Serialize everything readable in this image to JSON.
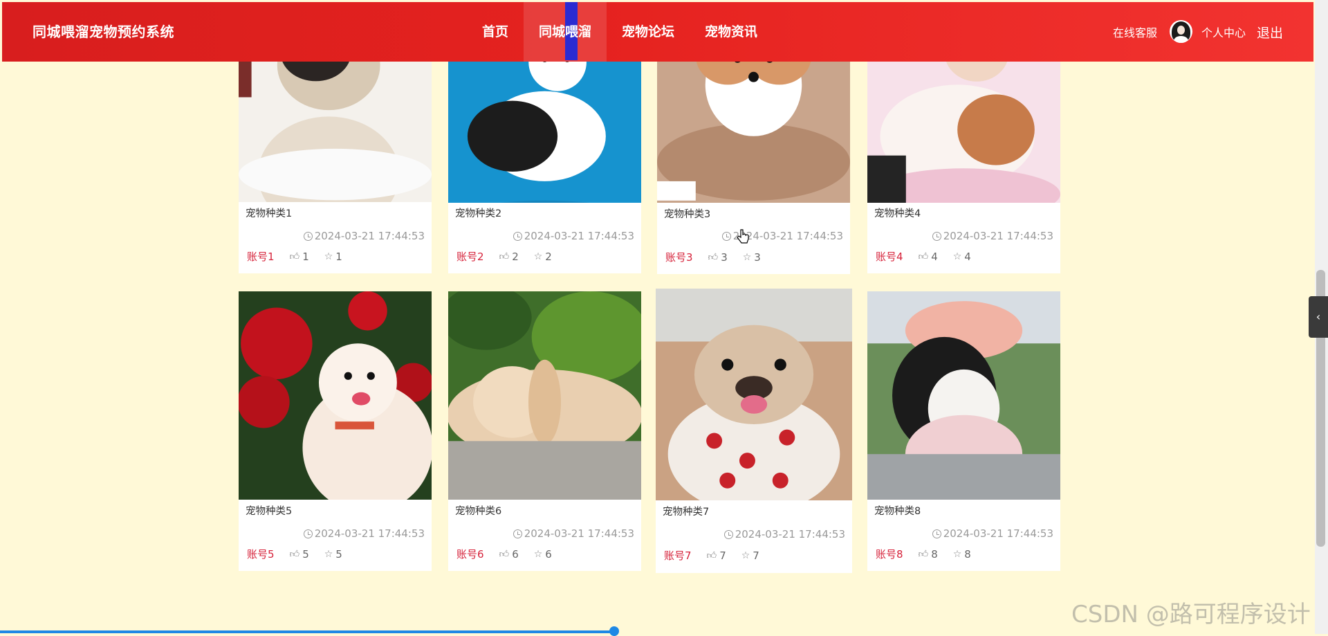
{
  "header": {
    "brand": "同城喂溜宠物预约系统",
    "nav": [
      {
        "label": "首页",
        "active": false
      },
      {
        "label": "同城喂溜",
        "active": true
      },
      {
        "label": "宠物论坛",
        "active": false
      },
      {
        "label": "宠物资讯",
        "active": false
      }
    ],
    "service_label": "在线客服",
    "center_label": "个人中心",
    "logout_label": "退出"
  },
  "cards": [
    {
      "name": "宠物种类1",
      "time": "2024-03-21 17:44:53",
      "account": "账号1",
      "likes": "1",
      "favorites": "1",
      "image": "pug puppy"
    },
    {
      "name": "宠物种类2",
      "time": "2024-03-21 17:44:53",
      "account": "账号2",
      "likes": "2",
      "favorites": "2",
      "image": "tricolor corgi puppy"
    },
    {
      "name": "宠物种类3",
      "time": "2024-03-21 17:44:53",
      "account": "账号3",
      "likes": "3",
      "favorites": "3",
      "image": "corgi puppy on blanket"
    },
    {
      "name": "宠物种类4",
      "time": "2024-03-21 17:44:53",
      "account": "账号4",
      "likes": "4",
      "favorites": "4",
      "image": "chihuahua puppy"
    },
    {
      "name": "宠物种类5",
      "time": "2024-03-21 17:44:53",
      "account": "账号5",
      "likes": "5",
      "favorites": "5",
      "image": "pomeranian with roses"
    },
    {
      "name": "宠物种类6",
      "time": "2024-03-21 17:44:53",
      "account": "账号6",
      "likes": "6",
      "favorites": "6",
      "image": "lop rabbit"
    },
    {
      "name": "宠物种类7",
      "time": "2024-03-21 17:44:53",
      "account": "账号7",
      "likes": "7",
      "favorites": "7",
      "image": "french bulldog in shirt"
    },
    {
      "name": "宠物种类8",
      "time": "2024-03-21 17:44:53",
      "account": "账号8",
      "likes": "8",
      "favorites": "8",
      "image": "poodle with pink bow"
    }
  ],
  "watermark": "CSDN @路可程序设计",
  "icons": {
    "time": "clock-icon",
    "likes": "thumbs-up-icon",
    "favorites": "star-icon",
    "side_tab": "chevron-left-icon"
  },
  "colors": {
    "nav_bg": "#e5221f",
    "page_bg": "#fff9d7",
    "account_red": "#d6223a",
    "active_marker": "#2b2bd1"
  }
}
